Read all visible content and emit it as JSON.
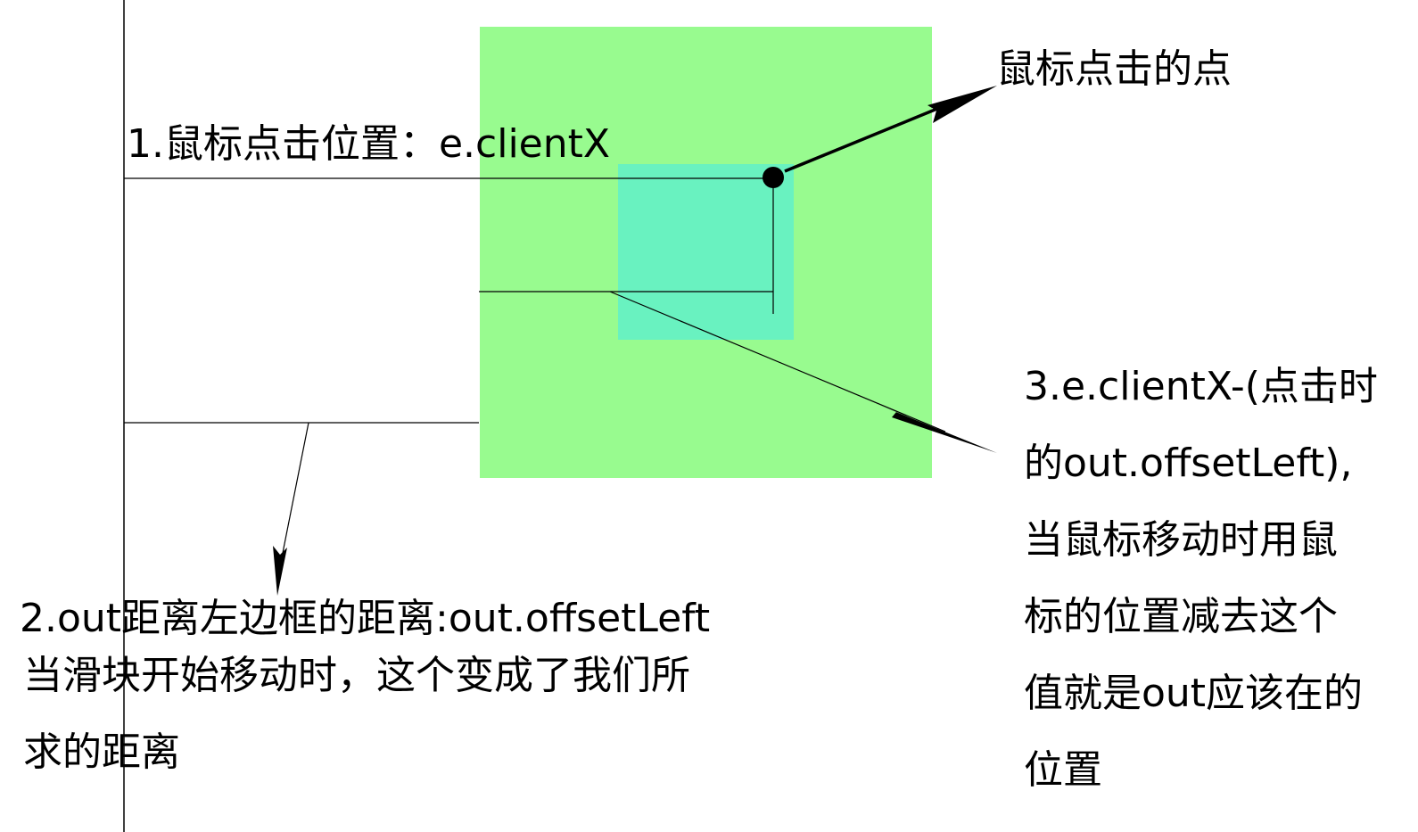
{
  "labels": {
    "click_point": "鼠标点击的点",
    "client_x": "1.鼠标点击位置：e.clientX",
    "offset_left": "2.out距离左边框的距离:out.offsetLeft"
  },
  "note_left": {
    "lines": [
      "当滑块开始移动时，这个变成了我们所",
      "求的距离"
    ]
  },
  "note_right": {
    "lines": [
      "3.e.clientX-(点击时",
      "的out.offsetLeft),",
      "当鼠标移动时用鼠",
      "标的位置减去这个",
      "值就是out应该在的",
      "位置"
    ]
  },
  "colors": {
    "outer_box": "#98fb8f",
    "inner_box": "#69f2c0",
    "lines": "#000000",
    "background": "#ffffff"
  }
}
